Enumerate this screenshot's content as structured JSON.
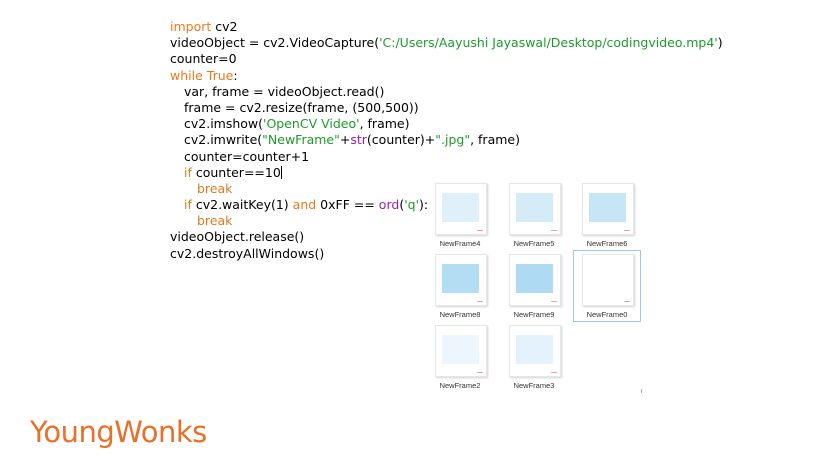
{
  "code": {
    "line1": {
      "kw": "import",
      "rest": " cv2"
    },
    "line2": {
      "pre": "videoObject = cv2.VideoCapture(",
      "str": "'C:/Users/Aayushi Jayaswal/Desktop/codingvideo.mp4'",
      "post": ")"
    },
    "line3": {
      "text": "counter=0"
    },
    "line4": {
      "kw": "while",
      "kw2": "True",
      "post": ":"
    },
    "line5": {
      "text": "var, frame = videoObject.read()"
    },
    "line6": {
      "text": "frame = cv2.resize(frame, (500,500))"
    },
    "line7": {
      "pre": "cv2.imshow(",
      "str": "'OpenCV Video'",
      "post": ", frame)"
    },
    "line8": {
      "pre": "cv2.imwrite(",
      "str": "\"NewFrame\"",
      "mid": "+",
      "fn": "str",
      "mid2": "(counter)+",
      "str2": "\".jpg\"",
      "post": ", frame)"
    },
    "line9": {
      "text": "counter=counter+1"
    },
    "line10": {
      "kw": "if",
      "pre": " counter==10"
    },
    "line11": {
      "kw": "break"
    },
    "line12": {
      "kw": "if",
      "mid": " cv2.waitKey(1) ",
      "kw2": "and",
      "mid2": " 0xFF == ",
      "fn": "ord",
      "mid3": "(",
      "str": "'q'",
      "post": "):"
    },
    "line13": {
      "kw": "break"
    },
    "line14": {
      "text": "videoObject.release()"
    },
    "line15": {
      "text": "cv2.destroyAllWindows()"
    }
  },
  "files": [
    {
      "name": "NewFrame4",
      "pic_color": "#dff0fa",
      "selected": false
    },
    {
      "name": "NewFrame5",
      "pic_color": "#d3ecf8",
      "selected": false
    },
    {
      "name": "NewFrame6",
      "pic_color": "#c6e6f7",
      "selected": false
    },
    {
      "name": "NewFrame8",
      "pic_color": "#b3ddf3",
      "selected": false
    },
    {
      "name": "NewFrame9",
      "pic_color": "#aedbf3",
      "selected": false
    },
    {
      "name": "NewFrame0",
      "pic_color": "#ffffff",
      "selected": true
    },
    {
      "name": "NewFrame2",
      "pic_color": "#edf6fc",
      "selected": false
    },
    {
      "name": "NewFrame3",
      "pic_color": "#e4f2fb",
      "selected": false
    }
  ],
  "brand": {
    "text": "YoungWonks",
    "color": "#e8702a"
  }
}
